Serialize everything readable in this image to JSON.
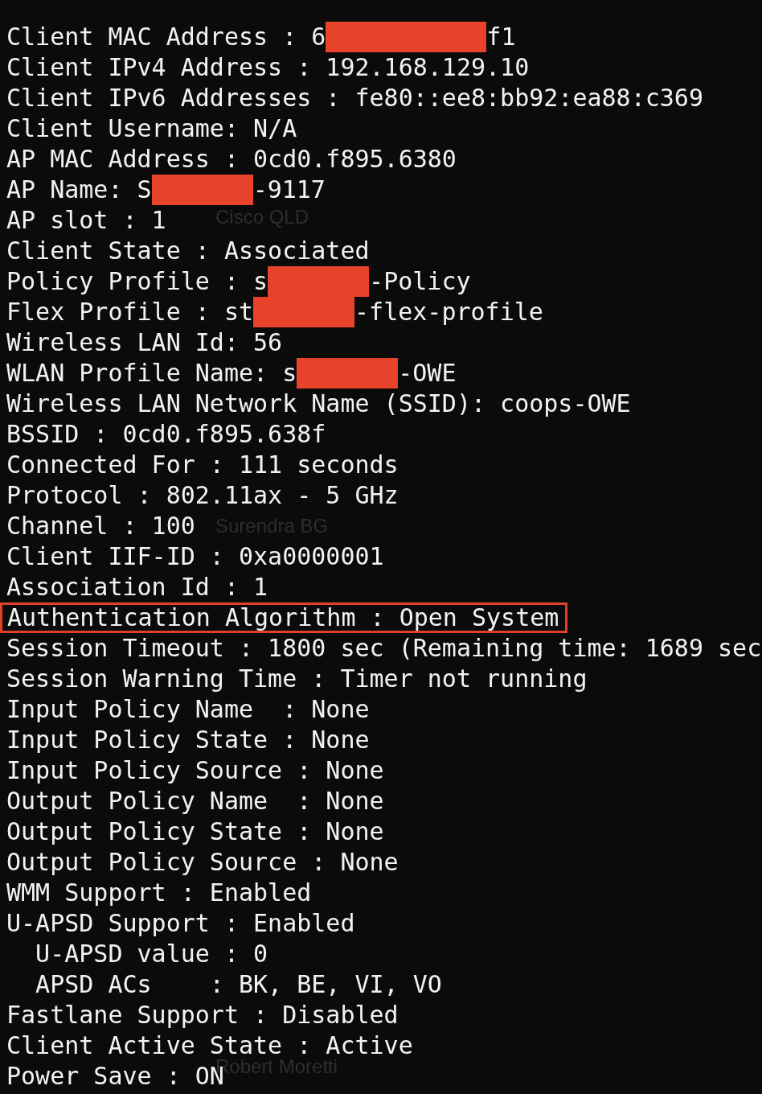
{
  "background_window": {
    "items": [
      {
        "text": "Cisco QLD"
      },
      {
        "text": "Surendra BG"
      },
      {
        "text": "Robert Moretti"
      }
    ]
  },
  "terminal": {
    "lines": [
      {
        "highlighted": false,
        "segments": [
          {
            "kind": "text",
            "text": "Client MAC Address : 6"
          },
          {
            "kind": "redaction_long"
          },
          {
            "kind": "text",
            "text": "f1"
          }
        ]
      },
      {
        "highlighted": false,
        "segments": [
          {
            "kind": "text",
            "text": "Client IPv4 Address : 192.168.129.10"
          }
        ]
      },
      {
        "highlighted": false,
        "segments": [
          {
            "kind": "text",
            "text": "Client IPv6 Addresses : fe80::ee8:bb92:ea88:c369"
          }
        ]
      },
      {
        "highlighted": false,
        "segments": [
          {
            "kind": "text",
            "text": "Client Username: N/A"
          }
        ]
      },
      {
        "highlighted": false,
        "segments": [
          {
            "kind": "text",
            "text": "AP MAC Address : 0cd0.f895.6380"
          }
        ]
      },
      {
        "highlighted": false,
        "segments": [
          {
            "kind": "text",
            "text": "AP Name: S"
          },
          {
            "kind": "redaction"
          },
          {
            "kind": "text",
            "text": "-9117"
          }
        ]
      },
      {
        "highlighted": false,
        "segments": [
          {
            "kind": "text",
            "text": "AP slot : 1"
          }
        ]
      },
      {
        "highlighted": false,
        "segments": [
          {
            "kind": "text",
            "text": "Client State : Associated"
          }
        ]
      },
      {
        "highlighted": false,
        "segments": [
          {
            "kind": "text",
            "text": "Policy Profile : s"
          },
          {
            "kind": "redaction"
          },
          {
            "kind": "text",
            "text": "-Policy"
          }
        ]
      },
      {
        "highlighted": false,
        "segments": [
          {
            "kind": "text",
            "text": "Flex Profile : st"
          },
          {
            "kind": "redaction"
          },
          {
            "kind": "text",
            "text": "-flex-profile"
          }
        ]
      },
      {
        "highlighted": false,
        "segments": [
          {
            "kind": "text",
            "text": "Wireless LAN Id: 56"
          }
        ]
      },
      {
        "highlighted": false,
        "segments": [
          {
            "kind": "text",
            "text": "WLAN Profile Name: s"
          },
          {
            "kind": "redaction"
          },
          {
            "kind": "text",
            "text": "-OWE"
          }
        ]
      },
      {
        "highlighted": false,
        "segments": [
          {
            "kind": "text",
            "text": "Wireless LAN Network Name (SSID): coops-OWE"
          }
        ]
      },
      {
        "highlighted": false,
        "segments": [
          {
            "kind": "text",
            "text": "BSSID : 0cd0.f895.638f"
          }
        ]
      },
      {
        "highlighted": false,
        "segments": [
          {
            "kind": "text",
            "text": "Connected For : 111 seconds"
          }
        ]
      },
      {
        "highlighted": false,
        "segments": [
          {
            "kind": "text",
            "text": "Protocol : 802.11ax - 5 GHz"
          }
        ]
      },
      {
        "highlighted": false,
        "segments": [
          {
            "kind": "text",
            "text": "Channel : 100"
          }
        ]
      },
      {
        "highlighted": false,
        "segments": [
          {
            "kind": "text",
            "text": "Client IIF-ID : 0xa0000001"
          }
        ]
      },
      {
        "highlighted": false,
        "segments": [
          {
            "kind": "text",
            "text": "Association Id : 1"
          }
        ]
      },
      {
        "highlighted": true,
        "segments": [
          {
            "kind": "text",
            "text": "Authentication Algorithm : Open System"
          }
        ]
      },
      {
        "highlighted": false,
        "segments": [
          {
            "kind": "text",
            "text": "Session Timeout : 1800 sec (Remaining time: 1689 sec"
          }
        ]
      },
      {
        "highlighted": false,
        "segments": [
          {
            "kind": "text",
            "text": "Session Warning Time : Timer not running"
          }
        ]
      },
      {
        "highlighted": false,
        "segments": [
          {
            "kind": "text",
            "text": "Input Policy Name  : None"
          }
        ]
      },
      {
        "highlighted": false,
        "segments": [
          {
            "kind": "text",
            "text": "Input Policy State : None"
          }
        ]
      },
      {
        "highlighted": false,
        "segments": [
          {
            "kind": "text",
            "text": "Input Policy Source : None"
          }
        ]
      },
      {
        "highlighted": false,
        "segments": [
          {
            "kind": "text",
            "text": "Output Policy Name  : None"
          }
        ]
      },
      {
        "highlighted": false,
        "segments": [
          {
            "kind": "text",
            "text": "Output Policy State : None"
          }
        ]
      },
      {
        "highlighted": false,
        "segments": [
          {
            "kind": "text",
            "text": "Output Policy Source : None"
          }
        ]
      },
      {
        "highlighted": false,
        "segments": [
          {
            "kind": "text",
            "text": "WMM Support : Enabled"
          }
        ]
      },
      {
        "highlighted": false,
        "segments": [
          {
            "kind": "text",
            "text": "U-APSD Support : Enabled"
          }
        ]
      },
      {
        "highlighted": false,
        "segments": [
          {
            "kind": "text",
            "text": "  U-APSD value : 0"
          }
        ]
      },
      {
        "highlighted": false,
        "segments": [
          {
            "kind": "text",
            "text": "  APSD ACs    : BK, BE, VI, VO"
          }
        ]
      },
      {
        "highlighted": false,
        "segments": [
          {
            "kind": "text",
            "text": "Fastlane Support : Disabled"
          }
        ]
      },
      {
        "highlighted": false,
        "segments": [
          {
            "kind": "text",
            "text": "Client Active State : Active"
          }
        ]
      },
      {
        "highlighted": false,
        "segments": [
          {
            "kind": "text",
            "text": "Power Save : ON"
          }
        ]
      }
    ]
  }
}
